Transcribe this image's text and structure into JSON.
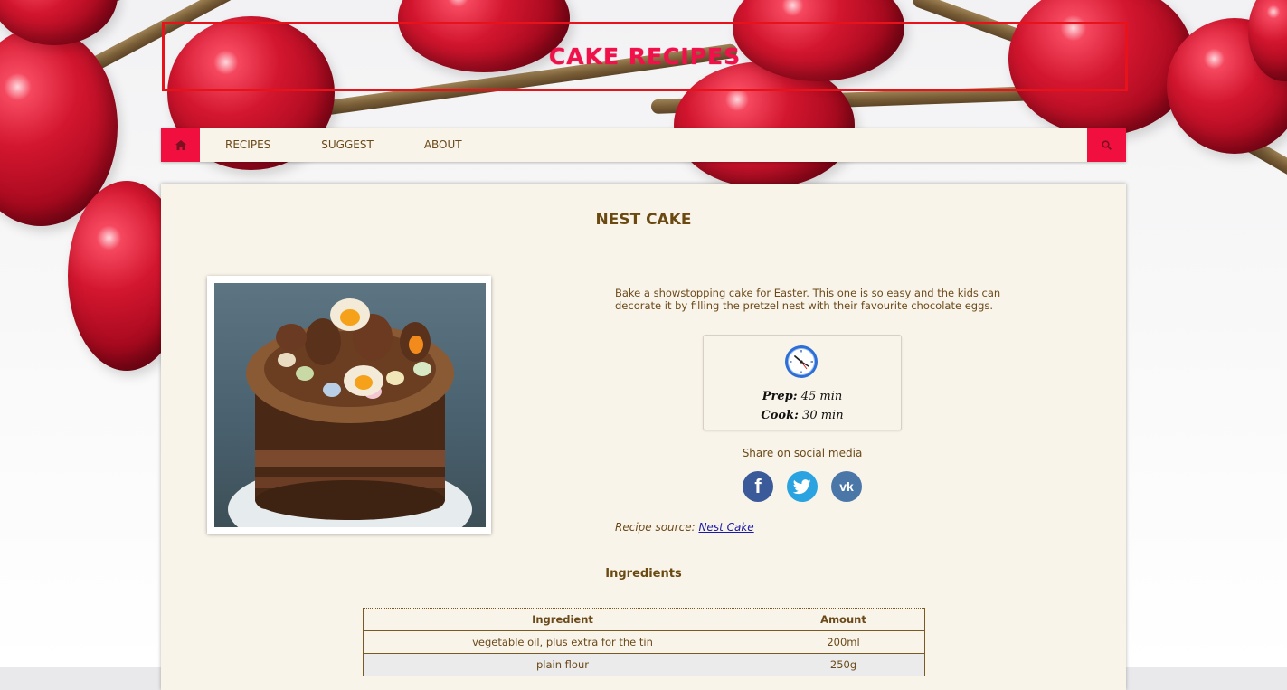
{
  "site": {
    "title": "CAKE RECIPES"
  },
  "nav": {
    "home_icon": "home-icon",
    "items": [
      {
        "label": "RECIPES"
      },
      {
        "label": "SUGGEST"
      },
      {
        "label": "ABOUT"
      }
    ],
    "search_icon": "search-icon"
  },
  "recipe": {
    "title": "NEST CAKE",
    "description": "Bake a showstopping cake for Easter. This one is so easy and the kids can decorate it by filling the pretzel nest with their favourite chocolate eggs.",
    "prep_label": "Prep:",
    "prep_value": "45 min",
    "cook_label": "Cook:",
    "cook_value": "30 min",
    "share_label": "Share on social media",
    "source_prefix": "Recipe source:",
    "source_link": "Nest Cake"
  },
  "ingredients": {
    "title": "Ingredients",
    "headers": [
      "Ingredient",
      "Amount"
    ],
    "rows": [
      [
        "vegetable oil, plus extra for the tin",
        "200ml"
      ],
      [
        "plain flour",
        "250g"
      ]
    ]
  },
  "colors": {
    "accent": "#f10f3f",
    "title_brown": "#6b4a12",
    "panel": "#f9f4ea"
  }
}
